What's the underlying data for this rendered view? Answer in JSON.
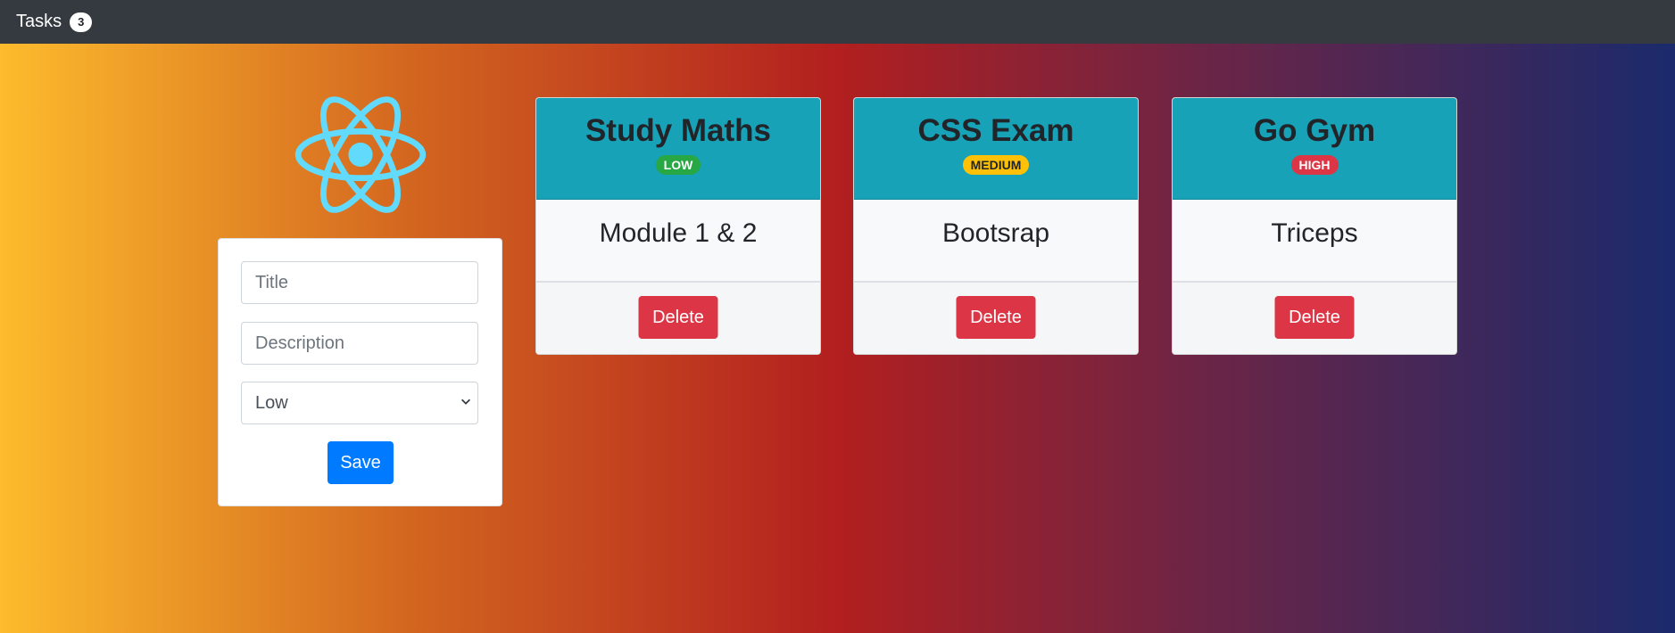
{
  "navbar": {
    "brand": "Tasks",
    "count": "3"
  },
  "form": {
    "title_placeholder": "Title",
    "description_placeholder": "Description",
    "priority_selected": "Low",
    "save_label": "Save"
  },
  "tasks": [
    {
      "title": "Study Maths",
      "priority": "LOW",
      "description": "Module 1 & 2",
      "delete_label": "Delete"
    },
    {
      "title": "CSS Exam",
      "priority": "MEDIUM",
      "description": "Bootsrap",
      "delete_label": "Delete"
    },
    {
      "title": "Go Gym",
      "priority": "HIGH",
      "description": "Triceps",
      "delete_label": "Delete"
    }
  ],
  "colors": {
    "navbar": "#343a40",
    "card_header": "#17a2b8",
    "save_button": "#007bff",
    "delete_button": "#dc3545",
    "badge_low": "#28a745",
    "badge_medium": "#ffc107",
    "badge_high": "#dc3545",
    "logo": "#61dafb"
  },
  "icons": {
    "logo": "react-atom-icon",
    "select_arrow": "chevron-down-icon"
  }
}
